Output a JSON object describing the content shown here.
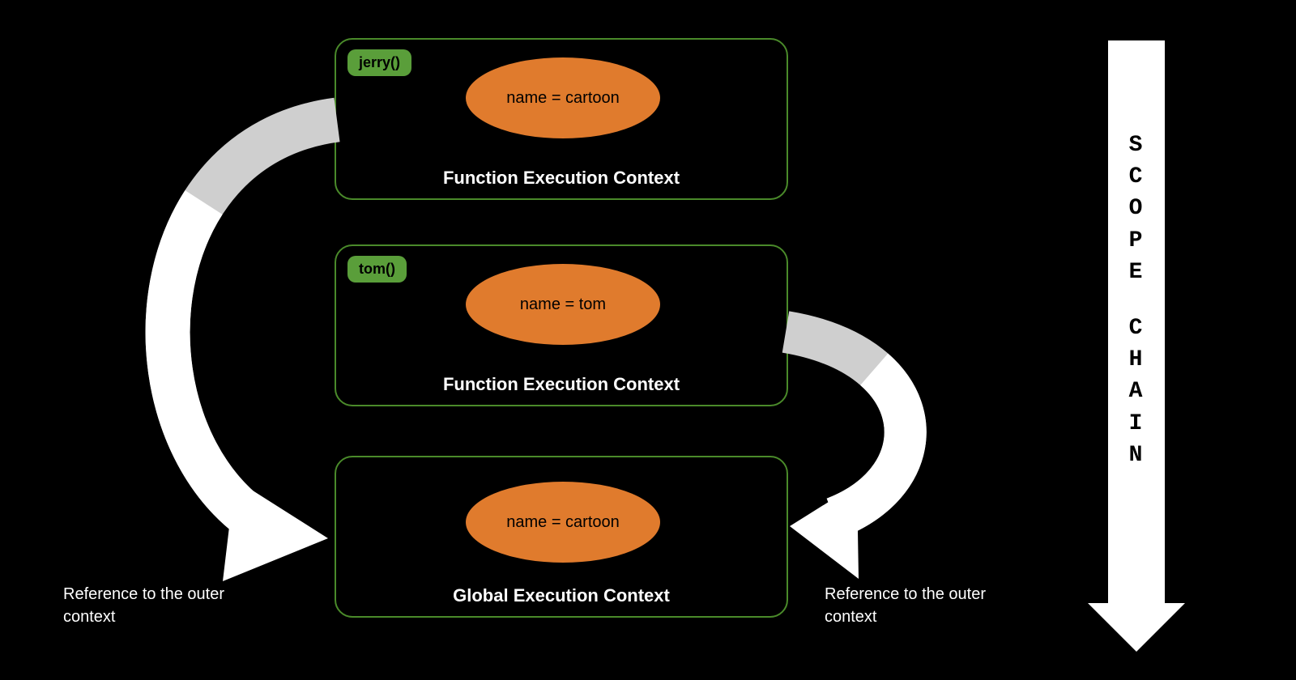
{
  "colors": {
    "background": "#000000",
    "box_border": "#4a8a2a",
    "tag_fill": "#5a9e3a",
    "ellipse_fill": "#e07b2d",
    "arrow_fill": "#ffffff",
    "arrow_ghost": "#cfcfcf",
    "text": "#ffffff"
  },
  "contexts": [
    {
      "id": "jerry",
      "tag": "jerry()",
      "variable": "name = cartoon",
      "title": "Function Execution Context"
    },
    {
      "id": "tom",
      "tag": "tom()",
      "variable": "name = tom",
      "title": "Function Execution Context"
    },
    {
      "id": "global",
      "tag": null,
      "variable": "name = cartoon",
      "title": "Global Execution Context"
    }
  ],
  "labels": {
    "left_ref": "Reference to the outer context",
    "right_ref": "Reference to the outer context"
  },
  "scope_chain": {
    "text_line1": "SCOPE",
    "text_line2": "CHAIN"
  }
}
